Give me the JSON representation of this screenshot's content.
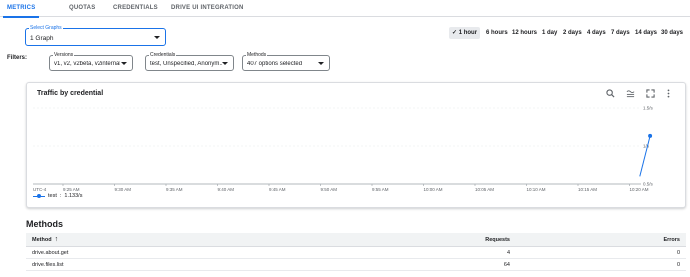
{
  "tabs": [
    {
      "label": "METRICS",
      "active": true
    },
    {
      "label": "QUOTAS",
      "active": false
    },
    {
      "label": "CREDENTIALS",
      "active": false
    },
    {
      "label": "DRIVE UI INTEGRATION",
      "active": false
    }
  ],
  "select_graphs": {
    "label": "Select Graphs",
    "value": "1 Graph"
  },
  "time_range": {
    "selected": "1 hour",
    "options": [
      "1 hour",
      "6 hours",
      "12 hours",
      "1 day",
      "2 days",
      "4 days",
      "7 days",
      "14 days",
      "30 days"
    ]
  },
  "filters": {
    "label": "Filters:",
    "versions": {
      "label": "Versions",
      "value": "v1, v2, v2beta, v2internal, ..."
    },
    "credentials": {
      "label": "Credentials",
      "value": "test, Unspecified, Anonym..."
    },
    "methods": {
      "label": "Methods",
      "value": "407 options selected"
    }
  },
  "chart": {
    "title": "Traffic by credential",
    "tools": [
      "zoom-icon",
      "compare-icon",
      "fullscreen-icon",
      "more-vert-icon"
    ]
  },
  "chart_data": {
    "type": "line",
    "title": "Traffic by credential",
    "timezone_label": "UTC-4",
    "x_tick_labels": [
      "9:25 AM",
      "9:30 AM",
      "9:35 AM",
      "9:40 AM",
      "9:45 AM",
      "9:50 AM",
      "9:55 AM",
      "10:00 AM",
      "10:05 AM",
      "10:10 AM",
      "10:15 AM",
      "10:20 AM"
    ],
    "y_tick_labels": [
      "1.5/s",
      "1/s",
      "0.5/s"
    ],
    "ylim": [
      0.5,
      1.5
    ],
    "grid": true,
    "legend_position": "bottom-left",
    "series": [
      {
        "name": "test",
        "legend_value": "1.133/s",
        "color": "#1a73e8",
        "points": [
          {
            "x": "10:21 AM",
            "y": 0.6
          },
          {
            "x": "10:22 AM",
            "y": 1.133
          }
        ]
      }
    ]
  },
  "methods": {
    "heading": "Methods",
    "columns": {
      "method": "Method",
      "requests": "Requests",
      "errors": "Errors"
    },
    "rows": [
      {
        "method": "drive.about.get",
        "requests": "4",
        "errors": "0"
      },
      {
        "method": "drive.files.list",
        "requests": "64",
        "errors": "0"
      }
    ]
  }
}
